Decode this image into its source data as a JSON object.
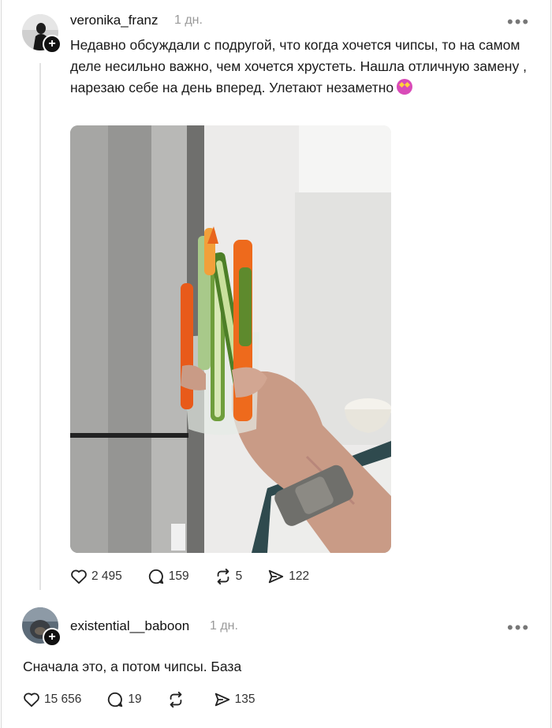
{
  "post": {
    "username": "veronika_franz",
    "time": "1 дн.",
    "text": "Недавно обсуждали с подругой, что когда хочется чипсы, то на самом деле несильно важно, чем хочется хрустеть. Нашла отличную замену , нарезаю себе на день вперед. Улетают незаметно",
    "emoji": "star-struck-emoji",
    "likes": "2 495",
    "comments": "159",
    "reposts": "5",
    "shares": "122"
  },
  "reply": {
    "username": "existential__baboon",
    "time": "1 дн.",
    "text": "Сначала это, а потом чипсы. База",
    "likes": "15 656",
    "comments": "19",
    "reposts": "",
    "shares": "135"
  },
  "icons": {
    "like": "heart-icon",
    "comment": "comment-bubble-icon",
    "repost": "repost-icon",
    "share": "send-icon",
    "more": "more-dots-icon",
    "follow": "plus-icon"
  }
}
